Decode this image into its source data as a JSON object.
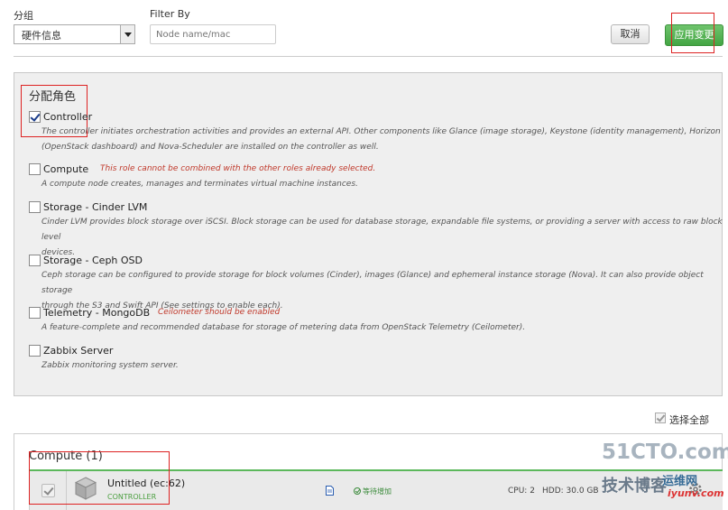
{
  "toolbar": {
    "group_label": "分组",
    "group_value": "硬件信息",
    "filter_label": "Filter By",
    "filter_placeholder": "Node name/mac",
    "cancel_label": "取消",
    "apply_label": "应用变更"
  },
  "roles": {
    "title": "分配角色",
    "items": [
      {
        "name": "Controller",
        "checked": true,
        "warning": "",
        "description_lines": [
          "The controller initiates orchestration activities and provides an external API. Other components like Glance (image storage), Keystone (identity management), Horizon",
          "(OpenStack dashboard) and Nova-Scheduler are installed on the controller as well."
        ]
      },
      {
        "name": "Compute",
        "checked": false,
        "warning": "This role cannot be combined with the other roles already selected.",
        "description_lines": [
          "A compute node creates, manages and terminates virtual machine instances."
        ]
      },
      {
        "name": "Storage - Cinder LVM",
        "checked": false,
        "warning": "",
        "description_lines": [
          "Cinder LVM provides block storage over iSCSI. Block storage can be used for database storage, expandable file systems, or providing a server with access to raw block level",
          "devices."
        ]
      },
      {
        "name": "Storage - Ceph OSD",
        "checked": false,
        "warning": "",
        "description_lines": [
          "Ceph storage can be configured to provide storage for block volumes (Cinder), images (Glance) and ephemeral instance storage (Nova). It can also provide object storage",
          "through the S3 and Swift API (See settings to enable each)."
        ]
      },
      {
        "name": "Telemetry - MongoDB",
        "checked": false,
        "warning": "Ceilometer should be enabled",
        "description_lines": [
          "A feature-complete and recommended database for storage of metering data from OpenStack Telemetry (Ceilometer)."
        ]
      },
      {
        "name": "Zabbix Server",
        "checked": false,
        "warning": "",
        "description_lines": [
          "Zabbix monitoring system server."
        ]
      }
    ]
  },
  "select_all_label": "选择全部",
  "group": {
    "title": "Compute (1)",
    "node": {
      "name": "Untitled (ec:62)",
      "role": "CONTROLLER",
      "status": "等待增加",
      "cpu": "CPU: 2",
      "hdd": "HDD: 30.0 GB"
    }
  },
  "watermark": {
    "line1": "51CTO.com",
    "line2": "技术博客",
    "line3": "运维网",
    "line4": "iyunv.com"
  },
  "colors": {
    "accent_green": "#4cae4c",
    "warning_red": "#c0392b",
    "annotation_red": "#dd2222"
  }
}
